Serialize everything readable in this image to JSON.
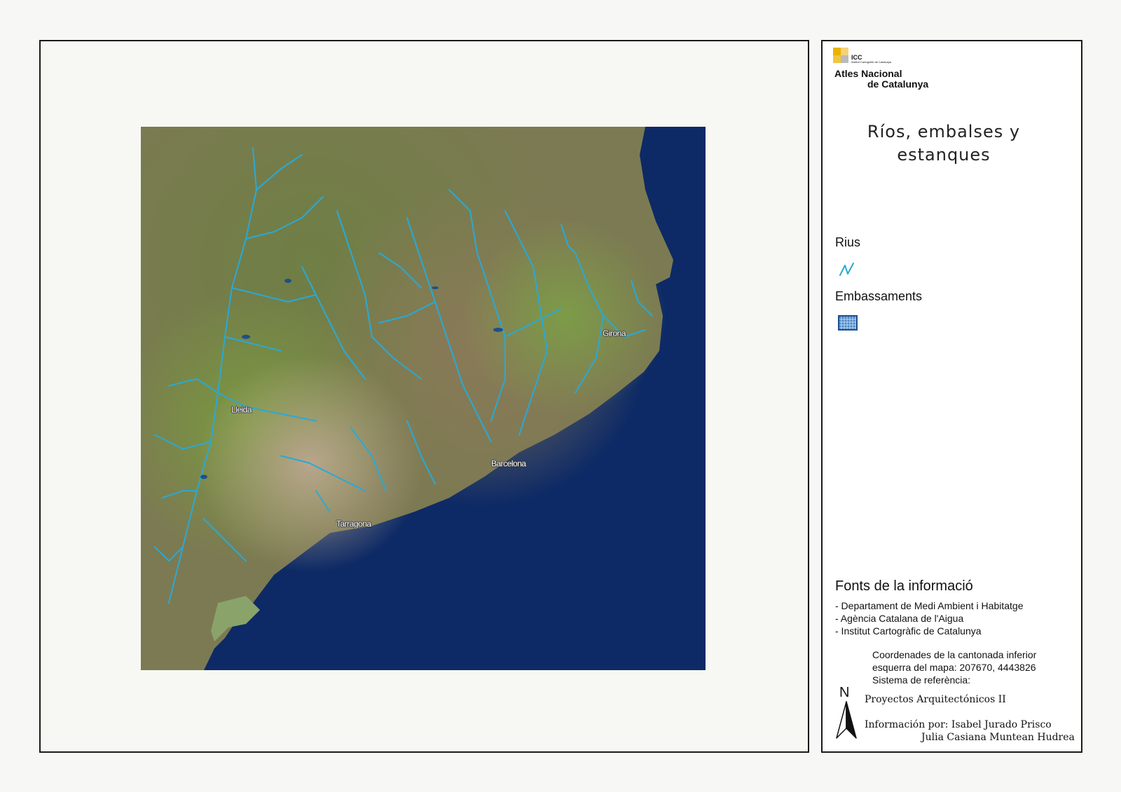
{
  "logo": {
    "abbrev": "ICC",
    "institute": "Institut Cartogràfic de Catalunya",
    "line1": "Atles Nacional",
    "line2": "de Catalunya"
  },
  "title": "Ríos, embalses y estanques",
  "legend": {
    "rivers_label": "Rius",
    "rivers_icon": "river-line-icon",
    "rivers_color": "#29a9d6",
    "reservoirs_label": "Embassaments",
    "reservoirs_icon": "reservoir-grid-icon",
    "reservoirs_color": "#1e4f8c"
  },
  "map": {
    "cities": [
      "Girona",
      "Lleida",
      "Barcelona",
      "Tarragona"
    ],
    "sea_color": "#0d2a66",
    "land_color": "#7c7a52"
  },
  "sources": {
    "heading": "Fonts de la informació",
    "items": [
      "- Departament de Medi Ambient i Habitatge",
      "- Agència Catalana de l'Aigua",
      "- Institut Cartogràfic de Catalunya"
    ]
  },
  "coordinates": {
    "line1": "Coordenades de la cantonada inferior",
    "line2": "esquerra del mapa: 207670, 4443826",
    "line3": "Sistema de referència:"
  },
  "north_label": "N",
  "credits": {
    "course": "Proyectos Arquitectónicos II",
    "info": "Información por: Isabel Jurado Prisco",
    "author2": "Julia Casiana Muntean Hudrea"
  }
}
